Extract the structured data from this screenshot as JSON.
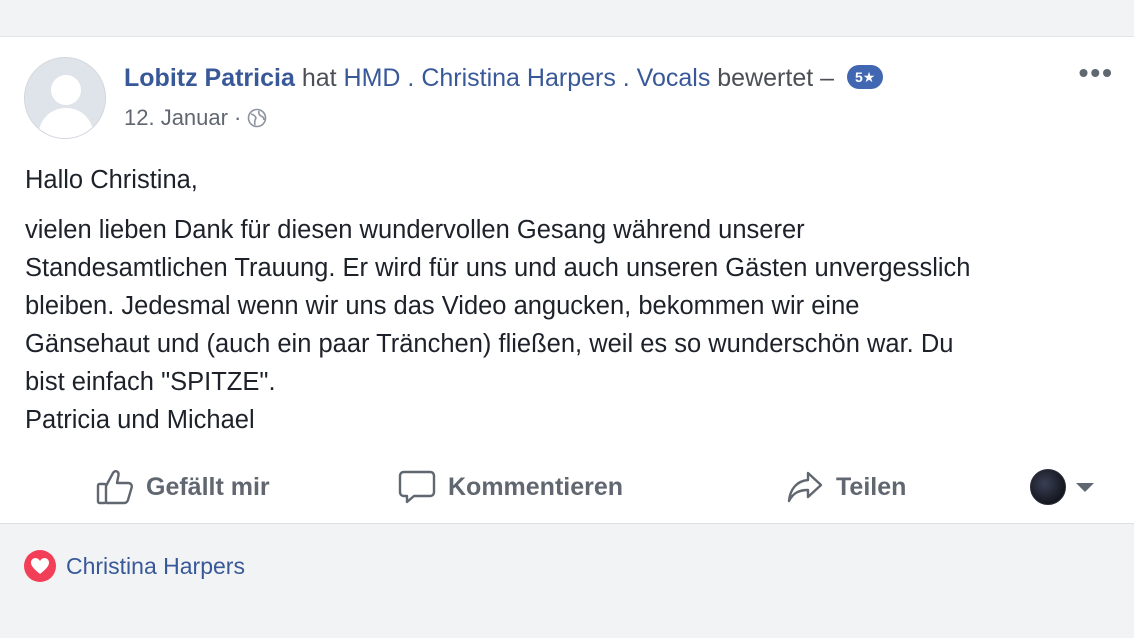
{
  "post": {
    "author": "Lobitz Patricia",
    "rated_text": "hat",
    "page_name": "HMD . Christina Harpers . Vocals",
    "rated_suffix": "bewertet –",
    "rating": "5★",
    "date": "12. Januar",
    "date_separator": "·",
    "privacy_icon": "globe-icon",
    "more_label": "•••",
    "greeting": "Hallo Christina,",
    "body_lines": [
      "vielen lieben Dank für diesen wundervollen Gesang während unserer",
      "Standesamtlichen Trauung. Er wird für uns und auch unseren Gästen unvergesslich",
      "bleiben. Jedesmal wenn wir uns das Video angucken, bekommen wir eine",
      "Gänsehaut und (auch ein paar Tränchen) fließen, weil es so wunderschön war. Du",
      "bist einfach \"SPITZE\".",
      "Patricia und Michael"
    ]
  },
  "actions": {
    "like_label": "Gefällt mir",
    "comment_label": "Kommentieren",
    "share_label": "Teilen"
  },
  "reactions": {
    "icon": "heart-icon",
    "name": "Christina Harpers"
  },
  "colors": {
    "link": "#385898",
    "badge": "#4267b2",
    "heart": "#f33e58",
    "muted": "#606770"
  }
}
